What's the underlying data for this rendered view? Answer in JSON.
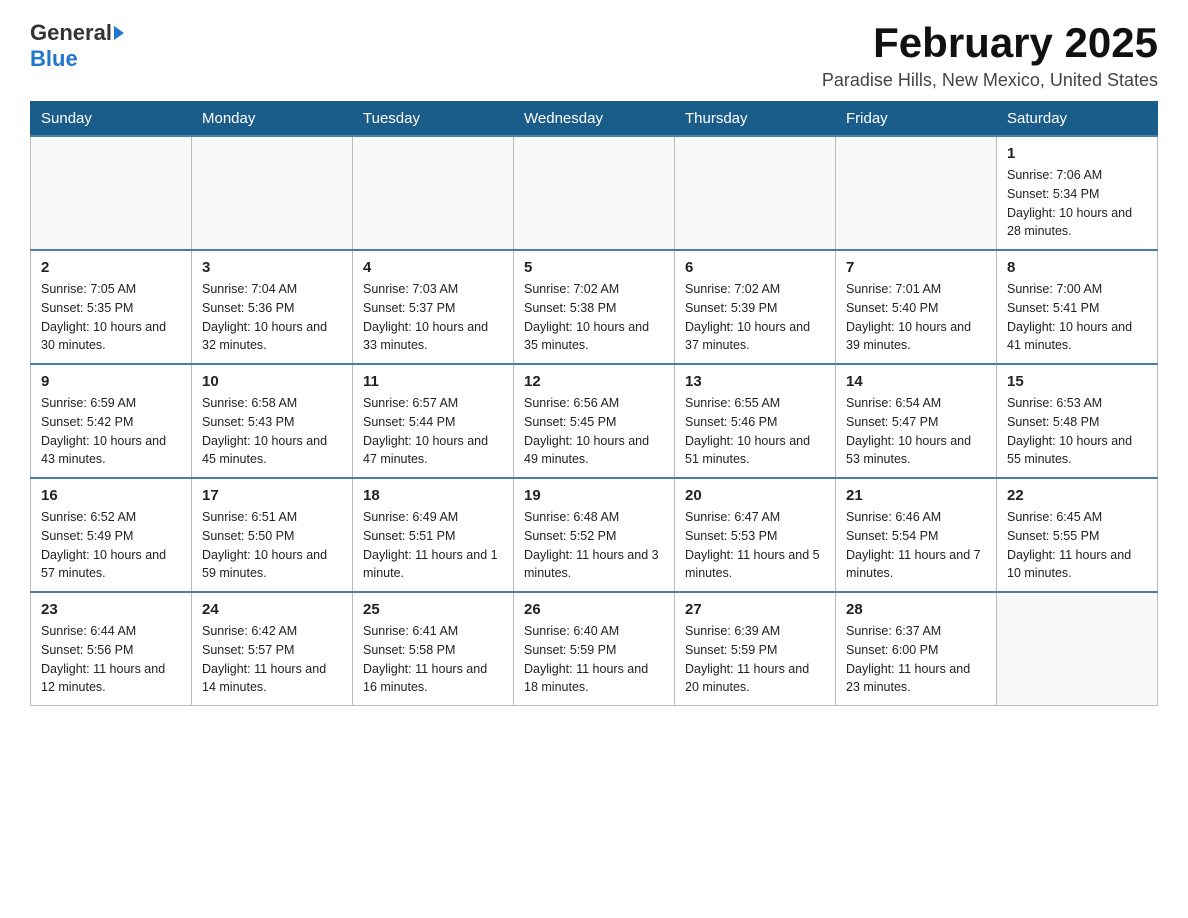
{
  "header": {
    "logo_general": "General",
    "logo_blue": "Blue",
    "month_title": "February 2025",
    "location": "Paradise Hills, New Mexico, United States"
  },
  "days_of_week": [
    "Sunday",
    "Monday",
    "Tuesday",
    "Wednesday",
    "Thursday",
    "Friday",
    "Saturday"
  ],
  "weeks": [
    [
      {
        "day": "",
        "info": ""
      },
      {
        "day": "",
        "info": ""
      },
      {
        "day": "",
        "info": ""
      },
      {
        "day": "",
        "info": ""
      },
      {
        "day": "",
        "info": ""
      },
      {
        "day": "",
        "info": ""
      },
      {
        "day": "1",
        "info": "Sunrise: 7:06 AM\nSunset: 5:34 PM\nDaylight: 10 hours and 28 minutes."
      }
    ],
    [
      {
        "day": "2",
        "info": "Sunrise: 7:05 AM\nSunset: 5:35 PM\nDaylight: 10 hours and 30 minutes."
      },
      {
        "day": "3",
        "info": "Sunrise: 7:04 AM\nSunset: 5:36 PM\nDaylight: 10 hours and 32 minutes."
      },
      {
        "day": "4",
        "info": "Sunrise: 7:03 AM\nSunset: 5:37 PM\nDaylight: 10 hours and 33 minutes."
      },
      {
        "day": "5",
        "info": "Sunrise: 7:02 AM\nSunset: 5:38 PM\nDaylight: 10 hours and 35 minutes."
      },
      {
        "day": "6",
        "info": "Sunrise: 7:02 AM\nSunset: 5:39 PM\nDaylight: 10 hours and 37 minutes."
      },
      {
        "day": "7",
        "info": "Sunrise: 7:01 AM\nSunset: 5:40 PM\nDaylight: 10 hours and 39 minutes."
      },
      {
        "day": "8",
        "info": "Sunrise: 7:00 AM\nSunset: 5:41 PM\nDaylight: 10 hours and 41 minutes."
      }
    ],
    [
      {
        "day": "9",
        "info": "Sunrise: 6:59 AM\nSunset: 5:42 PM\nDaylight: 10 hours and 43 minutes."
      },
      {
        "day": "10",
        "info": "Sunrise: 6:58 AM\nSunset: 5:43 PM\nDaylight: 10 hours and 45 minutes."
      },
      {
        "day": "11",
        "info": "Sunrise: 6:57 AM\nSunset: 5:44 PM\nDaylight: 10 hours and 47 minutes."
      },
      {
        "day": "12",
        "info": "Sunrise: 6:56 AM\nSunset: 5:45 PM\nDaylight: 10 hours and 49 minutes."
      },
      {
        "day": "13",
        "info": "Sunrise: 6:55 AM\nSunset: 5:46 PM\nDaylight: 10 hours and 51 minutes."
      },
      {
        "day": "14",
        "info": "Sunrise: 6:54 AM\nSunset: 5:47 PM\nDaylight: 10 hours and 53 minutes."
      },
      {
        "day": "15",
        "info": "Sunrise: 6:53 AM\nSunset: 5:48 PM\nDaylight: 10 hours and 55 minutes."
      }
    ],
    [
      {
        "day": "16",
        "info": "Sunrise: 6:52 AM\nSunset: 5:49 PM\nDaylight: 10 hours and 57 minutes."
      },
      {
        "day": "17",
        "info": "Sunrise: 6:51 AM\nSunset: 5:50 PM\nDaylight: 10 hours and 59 minutes."
      },
      {
        "day": "18",
        "info": "Sunrise: 6:49 AM\nSunset: 5:51 PM\nDaylight: 11 hours and 1 minute."
      },
      {
        "day": "19",
        "info": "Sunrise: 6:48 AM\nSunset: 5:52 PM\nDaylight: 11 hours and 3 minutes."
      },
      {
        "day": "20",
        "info": "Sunrise: 6:47 AM\nSunset: 5:53 PM\nDaylight: 11 hours and 5 minutes."
      },
      {
        "day": "21",
        "info": "Sunrise: 6:46 AM\nSunset: 5:54 PM\nDaylight: 11 hours and 7 minutes."
      },
      {
        "day": "22",
        "info": "Sunrise: 6:45 AM\nSunset: 5:55 PM\nDaylight: 11 hours and 10 minutes."
      }
    ],
    [
      {
        "day": "23",
        "info": "Sunrise: 6:44 AM\nSunset: 5:56 PM\nDaylight: 11 hours and 12 minutes."
      },
      {
        "day": "24",
        "info": "Sunrise: 6:42 AM\nSunset: 5:57 PM\nDaylight: 11 hours and 14 minutes."
      },
      {
        "day": "25",
        "info": "Sunrise: 6:41 AM\nSunset: 5:58 PM\nDaylight: 11 hours and 16 minutes."
      },
      {
        "day": "26",
        "info": "Sunrise: 6:40 AM\nSunset: 5:59 PM\nDaylight: 11 hours and 18 minutes."
      },
      {
        "day": "27",
        "info": "Sunrise: 6:39 AM\nSunset: 5:59 PM\nDaylight: 11 hours and 20 minutes."
      },
      {
        "day": "28",
        "info": "Sunrise: 6:37 AM\nSunset: 6:00 PM\nDaylight: 11 hours and 23 minutes."
      },
      {
        "day": "",
        "info": ""
      }
    ]
  ]
}
